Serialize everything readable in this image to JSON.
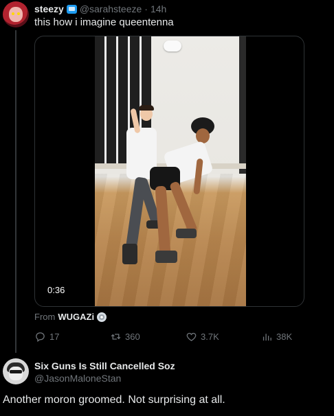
{
  "tweet": {
    "author_name": "steezy",
    "author_handle": "@sarahsteeze",
    "separator": "·",
    "time": "14h",
    "text": "this how i imagine queentenna",
    "media": {
      "duration": "0:36"
    },
    "source_label": "From",
    "source_name": "WUGAZi",
    "actions": {
      "replies": "17",
      "reposts": "360",
      "likes": "3.7K",
      "views": "38K"
    }
  },
  "reply": {
    "author_name": "Six Guns Is Still Cancelled Soz",
    "author_handle": "@JasonMaloneStan",
    "text": "Another moron groomed. Not surprising at all."
  },
  "icons": {
    "verified": "tv-badge-icon",
    "reply": "reply-icon",
    "repost": "repost-icon",
    "like": "heart-icon",
    "views": "views-icon",
    "source": "disc-icon"
  },
  "colors": {
    "background": "#000000",
    "text": "#e7e9ea",
    "muted": "#71767b",
    "accent": "#1d9bf0"
  }
}
